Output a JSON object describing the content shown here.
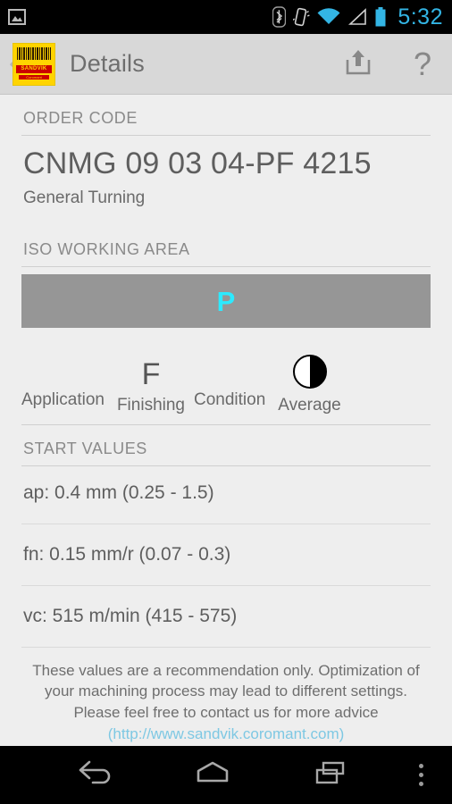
{
  "status_bar": {
    "notification_icon": "image-notification-icon",
    "icons": [
      "bluetooth-icon",
      "vibrate-icon",
      "wifi-icon",
      "cellular-signal-icon",
      "battery-icon"
    ],
    "clock": "5:32",
    "accent_color": "#33b5e5"
  },
  "app_bar": {
    "back_label": "‹",
    "logo_barcode_alt": "sandvik-barcode",
    "logo_brand": "SANDVIK",
    "logo_brand_sub": "Coromant",
    "title": "Details",
    "share_icon": "share-icon",
    "help_icon": "help-question-icon",
    "background": "#d8d8d8"
  },
  "sections": {
    "order_code_label": "ORDER CODE",
    "order_code": "CNMG 09 03 04-PF 4215",
    "order_category": "General Turning",
    "iso_label": "ISO WORKING AREA",
    "iso_letter": "P",
    "iso_bar_color": "#969696",
    "iso_letter_color": "#2ceaff",
    "start_values_label": "START VALUES"
  },
  "attributes": [
    {
      "label": "Application",
      "symbol": "F",
      "caption": "Finishing",
      "icon": "letter-f"
    },
    {
      "label": "Condition",
      "symbol": "",
      "caption": "Average",
      "icon": "half-filled-circle-icon"
    }
  ],
  "start_values": [
    "ap: 0.4 mm (0.25 - 1.5)",
    "fn: 0.15 mm/r (0.07 - 0.3)",
    "vc: 515 m/min (415 - 575)"
  ],
  "footnote": {
    "text": "These values are a recommendation only. Optimization of your machining process may lead to different settings. Please feel free to contact us for more advice",
    "link": "(http://www.sandvik.coromant.com)",
    "link_color": "#7ec8e3"
  },
  "nav_bar": {
    "back": "back-icon",
    "home": "home-icon",
    "recents": "recents-icon",
    "menu": "overflow-menu-icon"
  }
}
